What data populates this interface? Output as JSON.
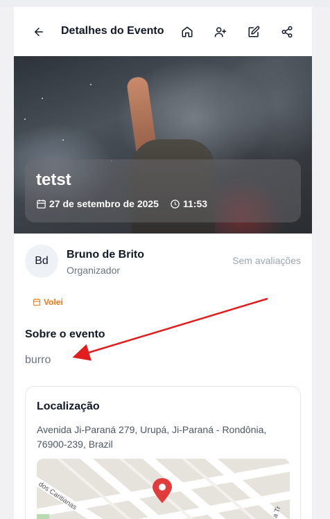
{
  "header": {
    "title": "Detalhes do Evento",
    "icons": [
      "arrow-left-icon",
      "home-icon",
      "user-plus-icon",
      "edit-icon",
      "share-icon"
    ]
  },
  "event": {
    "title": "tetst",
    "date": "27 de setembro de 2025",
    "time": "11:53"
  },
  "organizer": {
    "initials": "Bd",
    "name": "Bruno de Brito",
    "role": "Organizador",
    "rating": "Sem avaliações"
  },
  "category": {
    "label": "Volei"
  },
  "about": {
    "title": "Sobre o evento",
    "text": "burro"
  },
  "location": {
    "title": "Localização",
    "address": "Avenida Ji-Paraná 279, Urupá, Ji-Paraná - Rondônia, 76900-239, Brazil",
    "map_labels": [
      "dos Caritianas",
      "a Tr"
    ]
  },
  "colors": {
    "accent": "#f97316",
    "annotation_arrow": "#e11d1d",
    "map_pin": "#e23b3b"
  }
}
